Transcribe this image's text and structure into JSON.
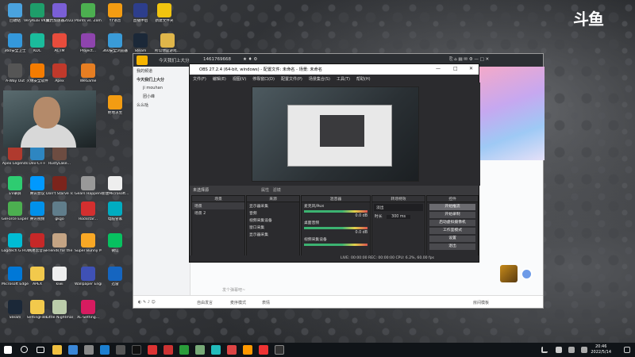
{
  "desktop": {
    "watermark": "斗鱼",
    "icons": [
      {
        "label": "回收站"
      },
      {
        "label": "VeryKuai VK加速器"
      },
      {
        "label": "聚力加速器2022"
      },
      {
        "label": "Plants vs. Zombies 3..."
      },
      {
        "label": "YY语音"
      },
      {
        "label": "直播伴侣"
      },
      {
        "label": "新建文件夹"
      },
      {
        "label": "所以你是游戏..."
      },
      {
        "label": "360安全卫士"
      },
      {
        "label": "KDC"
      },
      {
        "label": "ACTM"
      },
      {
        "label": "Project..."
      },
      {
        "label": "360安全浏览器"
      },
      {
        "label": "Steam"
      },
      {
        "label": "A-Way Out"
      },
      {
        "label": "火绒安全软件"
      },
      {
        "label": "Apex"
      },
      {
        "label": "WeGame"
      },
      {
        "label": "Apex Legends"
      },
      {
        "label": "Dev-C++"
      },
      {
        "label": "RustyLake..."
      },
      {
        "label": "360"
      },
      {
        "label": "EV录屏"
      },
      {
        "label": "腾讯会议"
      },
      {
        "label": "Don't Starve Together"
      },
      {
        "label": "Gears Happens"
      },
      {
        "label": "绝地求生"
      },
      {
        "label": "GeForce Experience"
      },
      {
        "label": "腾讯视频"
      },
      {
        "label": "gkgo"
      },
      {
        "label": "Rockstar..."
      },
      {
        "label": "新建Microsoft..."
      },
      {
        "label": "Logitech G HUB"
      },
      {
        "label": "网易云音乐"
      },
      {
        "label": "Friends for the Creator"
      },
      {
        "label": "Super Bunny Man"
      },
      {
        "label": "电脑管家"
      },
      {
        "label": "Microsoft Edge"
      },
      {
        "label": "APEX"
      },
      {
        "label": "kiwi"
      },
      {
        "label": "Wallpaper Engine"
      },
      {
        "label": "微信"
      },
      {
        "label": "Steam"
      },
      {
        "label": "SettingFiles"
      },
      {
        "label": "Little Nightmares"
      },
      {
        "label": "XL-Setting..."
      },
      {
        "label": "迅雷"
      }
    ]
  },
  "client": {
    "room_title": "今天我们上大分",
    "room_id": "1461769668",
    "sidebar": {
      "header": "我的频道",
      "group": "今天我们上大分",
      "item1": "ji mouhan",
      "item2": "团小峰",
      "item3": "么么哒"
    },
    "chat_placeholder": "发个弹幕吧~",
    "bottom": {
      "voice_btn": "自由发言",
      "mic_btn": "麦序模式",
      "emoji_btn": "表情",
      "right_btn": "房间模板"
    }
  },
  "obs": {
    "title": "OBS 27.2.4 (64-bit, windows) - 配置文件: 未命名 - 场景: 未命名",
    "menu": [
      "文件(F)",
      "编辑(E)",
      "视图(V)",
      "停靠窗口(D)",
      "配置文件(P)",
      "场景集合(S)",
      "工具(T)",
      "帮助(H)"
    ],
    "scene_label": "未选择源",
    "record_toggle": "属性",
    "filter_toggle": "滤镜",
    "docks": {
      "scenes": {
        "title": "场景",
        "items": [
          "场景",
          "场景 2"
        ]
      },
      "sources": {
        "title": "来源",
        "items": [
          "显示器采集",
          "音频",
          "视频采集设备",
          "窗口采集",
          "显示器采集"
        ]
      },
      "mixer": {
        "title": "混音器",
        "items": [
          {
            "name": "麦克风/Aux",
            "db": "0.0 dB"
          },
          {
            "name": "桌面音频",
            "db": "0.0 dB"
          },
          {
            "name": "视频采集设备",
            "db": "0.0 dB"
          }
        ]
      },
      "transitions": {
        "title": "转场特效",
        "mode": "淡出",
        "duration_label": "时长",
        "duration": "300 ms"
      },
      "controls": {
        "title": "控件",
        "buttons": [
          "开始推流",
          "开始录制",
          "启动虚拟摄像机",
          "工作室模式",
          "设置",
          "退出"
        ]
      }
    },
    "status": "LIVE: 00:00:00    REC: 00:00:00    CPU: 6.2%, 60.00 fps"
  },
  "tray": {
    "time": "20:46",
    "date": "2022/5/14"
  }
}
